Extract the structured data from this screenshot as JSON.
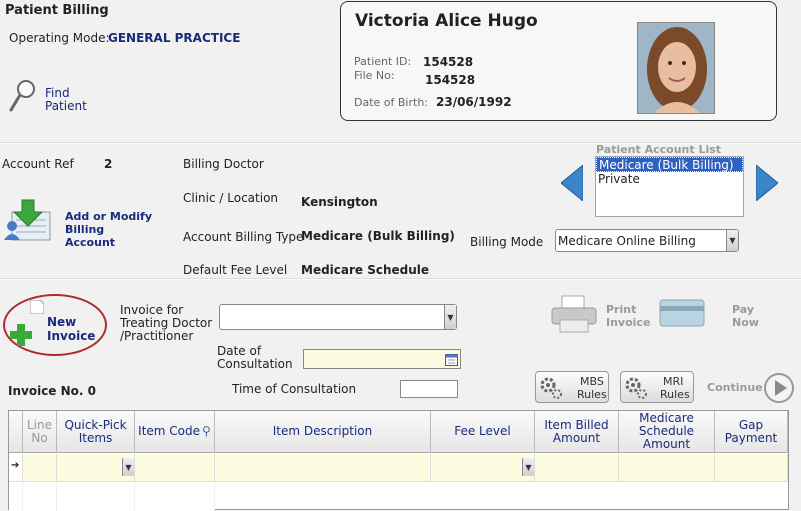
{
  "header": {
    "title": "Patient Billing",
    "operating_mode_label": "Operating Mode:",
    "operating_mode_value": "GENERAL PRACTICE",
    "find_patient_label_1": "Find",
    "find_patient_label_2": "Patient"
  },
  "patient": {
    "name": "Victoria Alice Hugo",
    "patient_id_label": "Patient ID:",
    "patient_id": "154528",
    "file_no_label": "File No:",
    "file_no": "154528",
    "dob_label": "Date of Birth:",
    "dob": "23/06/1992"
  },
  "account": {
    "account_ref_label": "Account Ref",
    "account_ref": "2",
    "billing_doctor_label": "Billing Doctor",
    "clinic_label": "Clinic / Location",
    "clinic_value": "Kensington",
    "billing_type_label": "Account Billing Type",
    "billing_type_value": "Medicare (Bulk Billing)",
    "fee_level_label": "Default Fee Level",
    "fee_level_value": "Medicare Schedule",
    "add_modify_1": "Add or Modify",
    "add_modify_2": "Billing Account",
    "billing_mode_label": "Billing Mode",
    "billing_mode_value": "Medicare Online Billing",
    "list_title": "Patient Account List",
    "list_items": [
      "Medicare (Bulk Billing)",
      "Private"
    ]
  },
  "invoice": {
    "new_1": "New",
    "new_2": "Invoice",
    "for_1": "Invoice for",
    "for_2": "Treating Doctor",
    "for_3": "/Practitioner",
    "date_1": "Date of",
    "date_2": "Consultation",
    "time_label": "Time of Consultation",
    "invoice_no": "Invoice No. 0",
    "print_1": "Print",
    "print_2": "Invoice",
    "pay_1": "Pay",
    "pay_2": "Now",
    "mbs_1": "MBS",
    "mbs_2": "Rules",
    "mri_1": "MRI",
    "mri_2": "Rules",
    "continue": "Continue"
  },
  "grid": {
    "columns": [
      {
        "l1": "Line",
        "l2": "No"
      },
      {
        "l1": "Quick-Pick",
        "l2": "Items"
      },
      {
        "l1": "Item Code",
        "l2": ""
      },
      {
        "l1": "Item Description",
        "l2": ""
      },
      {
        "l1": "Fee Level",
        "l2": ""
      },
      {
        "l1": "Item Billed",
        "l2": "Amount"
      },
      {
        "l1": "Medicare",
        "l2": "Schedule",
        "l3": "Amount"
      },
      {
        "l1": "Gap",
        "l2": "Payment"
      }
    ]
  },
  "colors": {
    "accent_navy": "#1a2a7a",
    "selection_blue": "#2f62c0",
    "row_yellow": "#fdfbe0",
    "plus_green": "#3aa83a"
  }
}
